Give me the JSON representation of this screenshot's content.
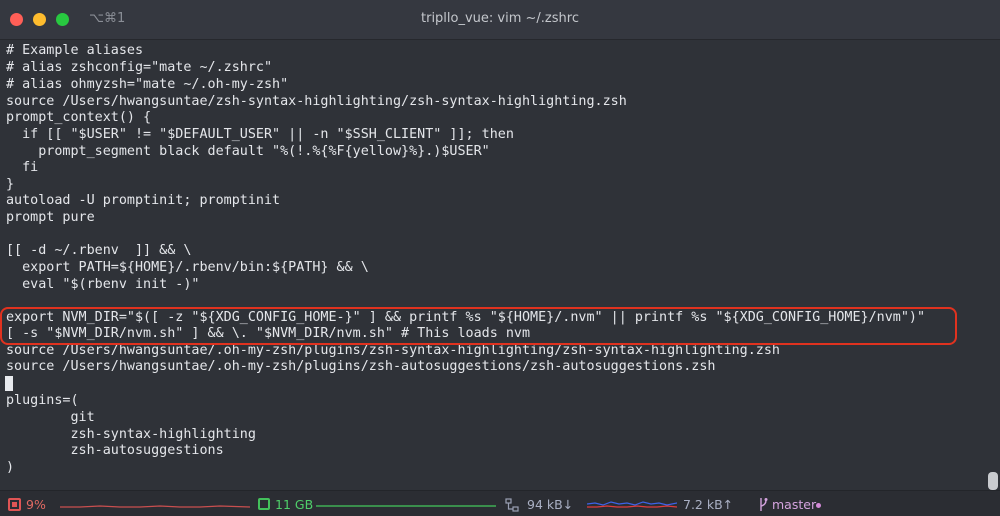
{
  "titlebar": {
    "shortcut": "⌥⌘1",
    "title": "tripllo_vue: vim ~/.zshrc"
  },
  "editor": {
    "lines": [
      "# Example aliases",
      "# alias zshconfig=\"mate ~/.zshrc\"",
      "# alias ohmyzsh=\"mate ~/.oh-my-zsh\"",
      "source /Users/hwangsuntae/zsh-syntax-highlighting/zsh-syntax-highlighting.zsh",
      "prompt_context() {",
      "  if [[ \"$USER\" != \"$DEFAULT_USER\" || -n \"$SSH_CLIENT\" ]]; then",
      "    prompt_segment black default \"%(!.%{%F{yellow}%}.)$USER\"",
      "  fi",
      "}",
      "autoload -U promptinit; promptinit",
      "prompt pure",
      "",
      "[[ -d ~/.rbenv  ]] && \\",
      "  export PATH=${HOME}/.rbenv/bin:${PATH} && \\",
      "  eval \"$(rbenv init -)\"",
      "",
      "export NVM_DIR=\"$([ -z \"${XDG_CONFIG_HOME-}\" ] && printf %s \"${HOME}/.nvm\" || printf %s \"${XDG_CONFIG_HOME}/nvm\")\"",
      "[ -s \"$NVM_DIR/nvm.sh\" ] && \\. \"$NVM_DIR/nvm.sh\" # This loads nvm",
      "source /Users/hwangsuntae/.oh-my-zsh/plugins/zsh-syntax-highlighting/zsh-syntax-highlighting.zsh",
      "source /Users/hwangsuntae/.oh-my-zsh/plugins/zsh-autosuggestions/zsh-autosuggestions.zsh",
      "",
      "plugins=(",
      "        git",
      "        zsh-syntax-highlighting",
      "        zsh-autosuggestions",
      ")"
    ]
  },
  "statusbar": {
    "cpu": "9%",
    "memory": "11 GB",
    "net_down": "94 kB↓",
    "net_up": "7.2 kB↑",
    "branch": "master"
  },
  "colors": {
    "cpu": "#e36a63",
    "memory": "#4fcf6a",
    "network": "#aab0c4",
    "branch": "#d4a3de",
    "highlight": "#e0321f"
  }
}
